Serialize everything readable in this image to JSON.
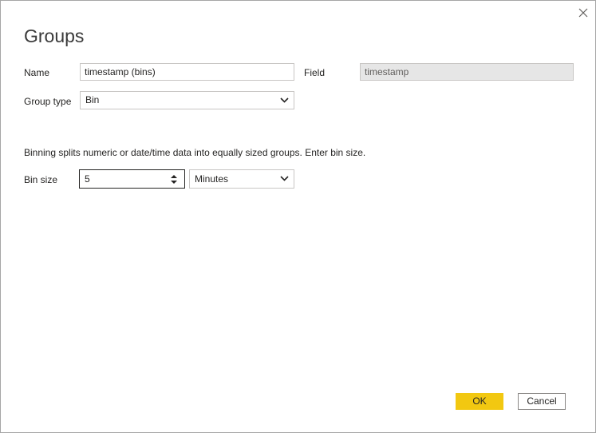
{
  "dialog": {
    "title": "Groups",
    "close_icon": "close-icon"
  },
  "name_field": {
    "label": "Name",
    "value": "timestamp (bins)"
  },
  "field_field": {
    "label": "Field",
    "value": "timestamp"
  },
  "group_type": {
    "label": "Group type",
    "selected": "Bin"
  },
  "description": "Binning splits numeric or date/time data into equally sized groups. Enter bin size.",
  "bin_size": {
    "label": "Bin size",
    "value": "5",
    "unit_selected": "Minutes"
  },
  "buttons": {
    "ok": "OK",
    "cancel": "Cancel"
  },
  "colors": {
    "accent": "#f2c811"
  }
}
